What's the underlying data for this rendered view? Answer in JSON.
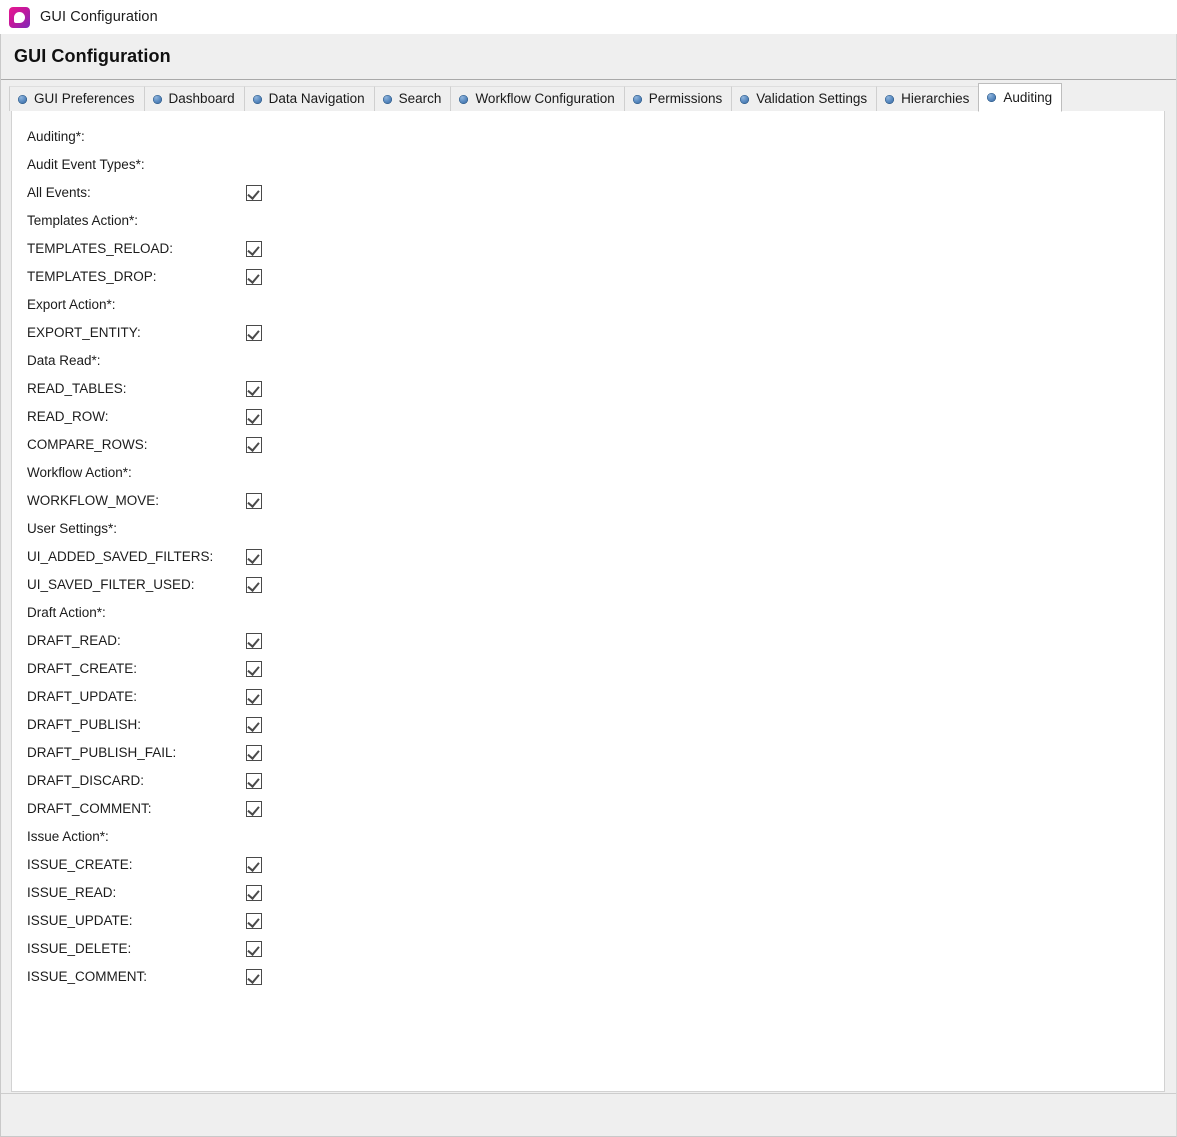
{
  "window": {
    "title": "GUI Configuration",
    "icon": "app-logo-icon"
  },
  "header": {
    "title": "GUI Configuration"
  },
  "tabs": [
    {
      "label": "GUI Preferences",
      "active": false
    },
    {
      "label": "Dashboard",
      "active": false
    },
    {
      "label": "Data Navigation",
      "active": false
    },
    {
      "label": "Search",
      "active": false
    },
    {
      "label": "Workflow Configuration",
      "active": false
    },
    {
      "label": "Permissions",
      "active": false
    },
    {
      "label": "Validation Settings",
      "active": false
    },
    {
      "label": "Hierarchies",
      "active": false
    },
    {
      "label": "Auditing",
      "active": true
    }
  ],
  "form": {
    "rows": [
      {
        "label": "Auditing*:",
        "type": "group"
      },
      {
        "label": "Audit Event Types*:",
        "type": "group"
      },
      {
        "label": "All Events:",
        "type": "checkbox",
        "checked": true
      },
      {
        "label": "Templates Action*:",
        "type": "group"
      },
      {
        "label": "TEMPLATES_RELOAD:",
        "type": "checkbox",
        "checked": true
      },
      {
        "label": "TEMPLATES_DROP:",
        "type": "checkbox",
        "checked": true
      },
      {
        "label": "Export Action*:",
        "type": "group"
      },
      {
        "label": "EXPORT_ENTITY:",
        "type": "checkbox",
        "checked": true
      },
      {
        "label": "Data Read*:",
        "type": "group"
      },
      {
        "label": "READ_TABLES:",
        "type": "checkbox",
        "checked": true
      },
      {
        "label": "READ_ROW:",
        "type": "checkbox",
        "checked": true
      },
      {
        "label": "COMPARE_ROWS:",
        "type": "checkbox",
        "checked": true
      },
      {
        "label": "Workflow Action*:",
        "type": "group"
      },
      {
        "label": "WORKFLOW_MOVE:",
        "type": "checkbox",
        "checked": true
      },
      {
        "label": "User Settings*:",
        "type": "group"
      },
      {
        "label": "UI_ADDED_SAVED_FILTERS:",
        "type": "checkbox",
        "checked": true
      },
      {
        "label": "UI_SAVED_FILTER_USED:",
        "type": "checkbox",
        "checked": true
      },
      {
        "label": "Draft Action*:",
        "type": "group"
      },
      {
        "label": "DRAFT_READ:",
        "type": "checkbox",
        "checked": true
      },
      {
        "label": "DRAFT_CREATE:",
        "type": "checkbox",
        "checked": true
      },
      {
        "label": "DRAFT_UPDATE:",
        "type": "checkbox",
        "checked": true
      },
      {
        "label": "DRAFT_PUBLISH:",
        "type": "checkbox",
        "checked": true
      },
      {
        "label": "DRAFT_PUBLISH_FAIL:",
        "type": "checkbox",
        "checked": true
      },
      {
        "label": "DRAFT_DISCARD:",
        "type": "checkbox",
        "checked": true
      },
      {
        "label": "DRAFT_COMMENT:",
        "type": "checkbox",
        "checked": true
      },
      {
        "label": "Issue Action*:",
        "type": "group"
      },
      {
        "label": "ISSUE_CREATE:",
        "type": "checkbox",
        "checked": true
      },
      {
        "label": "ISSUE_READ:",
        "type": "checkbox",
        "checked": true
      },
      {
        "label": "ISSUE_UPDATE:",
        "type": "checkbox",
        "checked": true
      },
      {
        "label": "ISSUE_DELETE:",
        "type": "checkbox",
        "checked": true
      },
      {
        "label": "ISSUE_COMMENT:",
        "type": "checkbox",
        "checked": true
      }
    ]
  },
  "colors": {
    "tab_bullet": "#2f6099",
    "header_bg": "#efefef",
    "panel_bg": "#ffffff",
    "checkbox_border": "#4a4a4a"
  }
}
